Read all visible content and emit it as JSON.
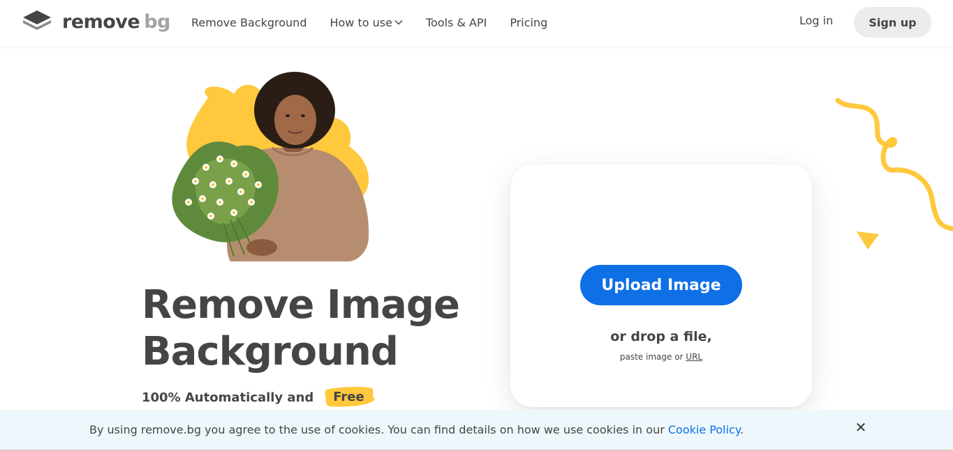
{
  "header": {
    "logo_word": "remove",
    "logo_bg": "bg",
    "nav": [
      {
        "label": "Remove Background"
      },
      {
        "label": "How to use"
      },
      {
        "label": "Tools & API"
      },
      {
        "label": "Pricing"
      }
    ],
    "login_label": "Log in",
    "signup_label": "Sign up"
  },
  "hero": {
    "title_line1": "Remove Image",
    "title_line2": "Background",
    "subtitle": "100% Automatically and",
    "free_label": "Free"
  },
  "upload": {
    "button_label": "Upload Image",
    "drop_text": "or drop a file,",
    "paste_text": "paste image or",
    "url_label": "URL"
  },
  "cookie": {
    "text": "By using remove.bg you agree to the use of cookies. You can find details on how we use cookies in our",
    "link_label": "Cookie Policy",
    "suffix": ".",
    "close_icon": "✕"
  },
  "colors": {
    "accent_blue": "#0f70e6",
    "yellow": "#ffc83d",
    "text": "#454545"
  }
}
